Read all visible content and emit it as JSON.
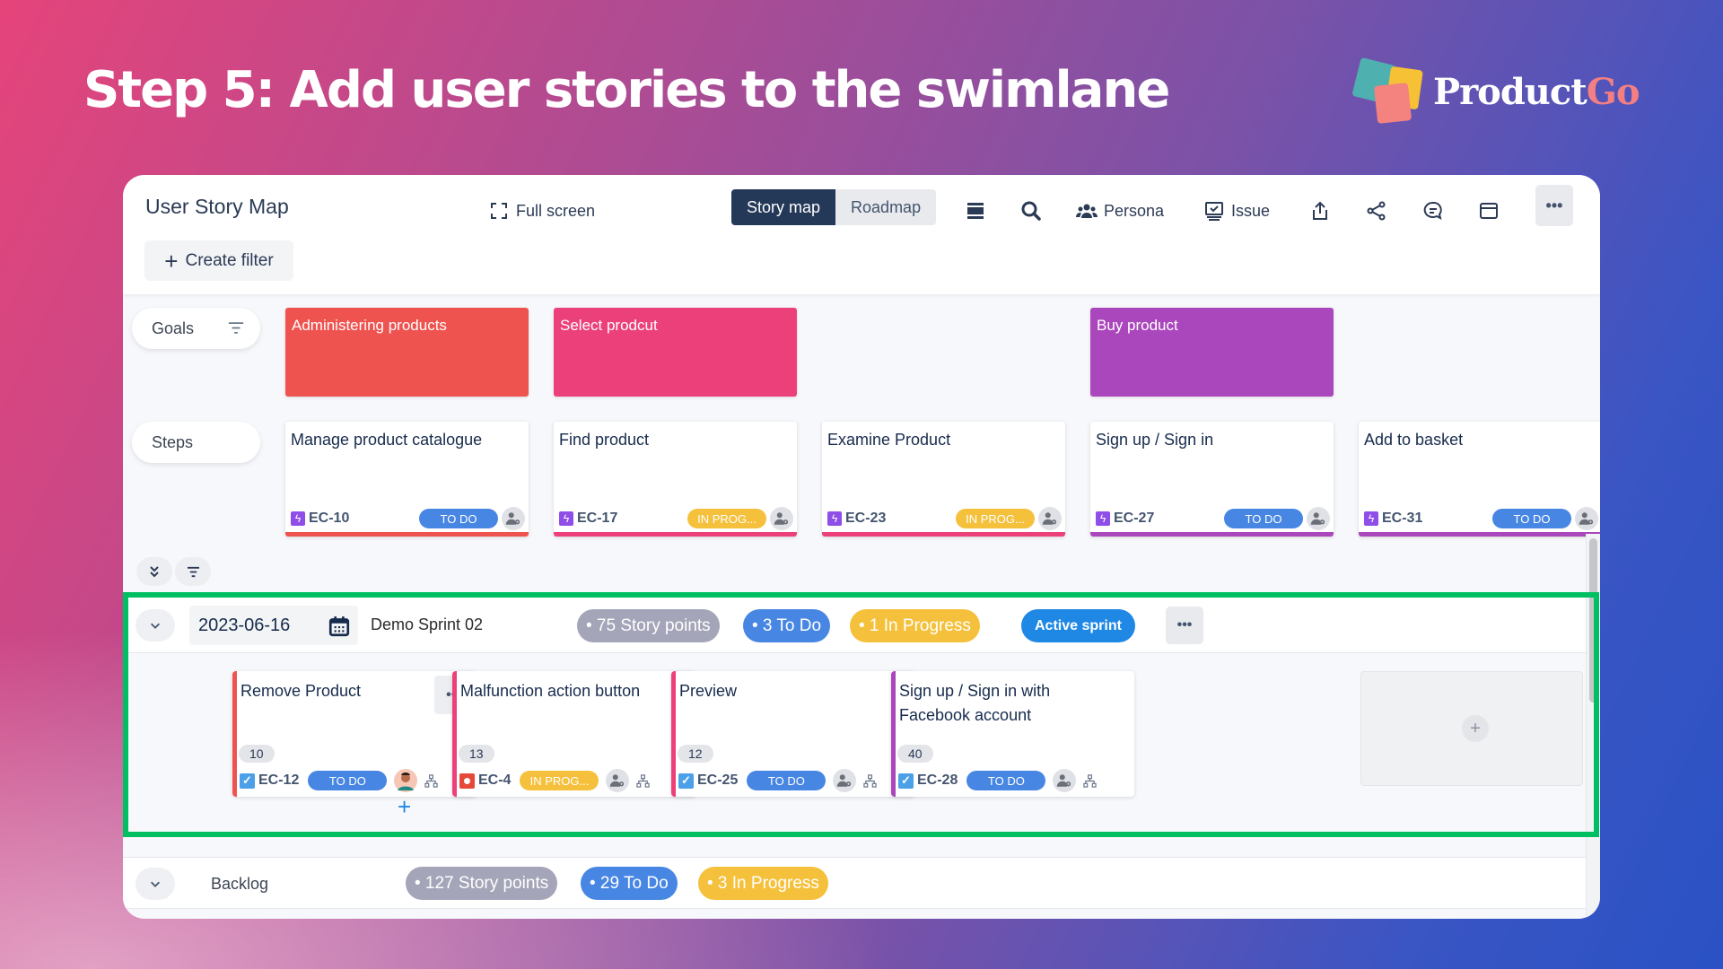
{
  "slide": {
    "headline": "Step 5: Add user stories to the swimlane",
    "logo": {
      "part1": "Product",
      "part2": "Go"
    }
  },
  "toolbar": {
    "title": "User Story Map",
    "create_filter": "Create filter",
    "full_screen": "Full screen",
    "view_tabs": [
      {
        "label": "Story map",
        "active": true
      },
      {
        "label": "Roadmap",
        "active": false
      }
    ],
    "persona": "Persona",
    "issue": "Issue",
    "more": "•••"
  },
  "rows": {
    "goals_label": "Goals",
    "steps_label": "Steps"
  },
  "goals": [
    {
      "title": "Administering products",
      "color": "#ef5350"
    },
    {
      "title": "Select prodcut",
      "color": "#ec407a"
    },
    {
      "title": "Buy product",
      "color": "#ab47bc"
    }
  ],
  "steps": [
    {
      "title": "Manage product catalogue",
      "key": "EC-10",
      "status": "TO DO",
      "status_type": "todo",
      "color": "#ef5350"
    },
    {
      "title": "Find product",
      "key": "EC-17",
      "status": "IN PROG...",
      "status_type": "inprog",
      "color": "#ec407a"
    },
    {
      "title": "Examine Product",
      "key": "EC-23",
      "status": "IN PROG...",
      "status_type": "inprog",
      "color": "#ec407a"
    },
    {
      "title": "Sign up / Sign in",
      "key": "EC-27",
      "status": "TO DO",
      "status_type": "todo",
      "color": "#ab47bc"
    },
    {
      "title": "Add to basket",
      "key": "EC-31",
      "status": "TO DO",
      "status_type": "todo",
      "color": "#ab47bc"
    }
  ],
  "sprint": {
    "date": "2023-06-16",
    "name": "Demo Sprint 02",
    "story_points": "• 75 Story points",
    "todo": "• 3 To Do",
    "in_progress": "• 1 In Progress",
    "badge": "Active sprint",
    "more": "•••"
  },
  "stories": [
    {
      "title": "Remove Product",
      "points": "10",
      "key": "EC-12",
      "type": "story",
      "status": "TO DO",
      "status_type": "todo",
      "color": "#ef5350",
      "assignee": "avatar"
    },
    {
      "title": "Malfunction action button",
      "points": "13",
      "key": "EC-4",
      "type": "bug",
      "status": "IN PROG...",
      "status_type": "inprog",
      "color": "#ec407a",
      "assignee": "unassigned"
    },
    {
      "title": "Preview",
      "points": "12",
      "key": "EC-25",
      "type": "story",
      "status": "TO DO",
      "status_type": "todo",
      "color": "#ec407a",
      "assignee": "unassigned"
    },
    {
      "title": "Sign up / Sign in with Facebook account",
      "points": "40",
      "key": "EC-28",
      "type": "story",
      "status": "TO DO",
      "status_type": "todo",
      "color": "#ab47bc",
      "assignee": "unassigned"
    }
  ],
  "story_more": "•••",
  "add_symbol": "+",
  "backlog": {
    "label": "Backlog",
    "story_points": "• 127 Story points",
    "todo": "• 29 To Do",
    "in_progress": "• 3 In Progress"
  },
  "colors": {
    "highlight": "#00bf62",
    "todo": "#4886e3",
    "in_progress": "#f5c13c",
    "active_sprint": "#1f88e5"
  }
}
